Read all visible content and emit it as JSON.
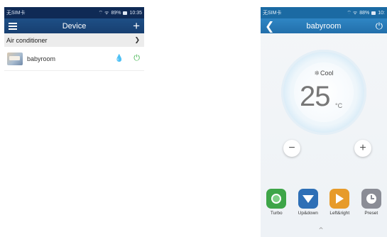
{
  "left": {
    "status": {
      "carrier": "无SIM卡",
      "right": "89%",
      "time": "10:35"
    },
    "header": {
      "title": "Device"
    },
    "section": {
      "label": "Air conditioner"
    },
    "devices": [
      {
        "name": "babyroom"
      }
    ]
  },
  "right": {
    "status": {
      "carrier": "无SIM卡",
      "right": "88%",
      "time": "10:"
    },
    "header": {
      "title": "babyroom"
    },
    "mode": "Cool",
    "temperature": "25",
    "unit": "°C",
    "functions": [
      {
        "label": "Turbo",
        "color": "#3ea548",
        "icon": "turbo-icon"
      },
      {
        "label": "Up&down",
        "color": "#2e6fb6",
        "icon": "swing-updown-icon"
      },
      {
        "label": "Left&right",
        "color": "#e79b2a",
        "icon": "swing-leftright-icon"
      },
      {
        "label": "Preset",
        "color": "#8b8d96",
        "icon": "clock-icon"
      }
    ]
  }
}
